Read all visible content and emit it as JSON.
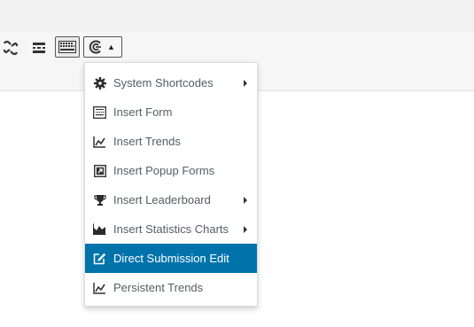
{
  "toolbar": {
    "icons": [
      "unlink-icon",
      "read-more-icon",
      "keyboard-icon",
      "formidable-icon"
    ],
    "dropdown_caret": "▲"
  },
  "menu": {
    "items": [
      {
        "label": "System Shortcodes",
        "icon": "gear-icon",
        "submenu": true
      },
      {
        "label": "Insert Form",
        "icon": "form-icon",
        "submenu": false
      },
      {
        "label": "Insert Trends",
        "icon": "trend-chart-icon",
        "submenu": false
      },
      {
        "label": "Insert Popup Forms",
        "icon": "popup-icon",
        "submenu": false
      },
      {
        "label": "Insert Leaderboard",
        "icon": "trophy-icon",
        "submenu": true
      },
      {
        "label": "Insert Statistics Charts",
        "icon": "area-chart-icon",
        "submenu": true
      },
      {
        "label": "Direct Submission Edit",
        "icon": "edit-icon",
        "submenu": false,
        "active": true
      },
      {
        "label": "Persistent Trends",
        "icon": "trend-chart-icon",
        "submenu": false
      }
    ]
  },
  "colors": {
    "active_bg": "#0073aa",
    "active_text": "#ffffff",
    "menu_text": "#555d66",
    "toolbar_bg": "#f6f6f6"
  }
}
